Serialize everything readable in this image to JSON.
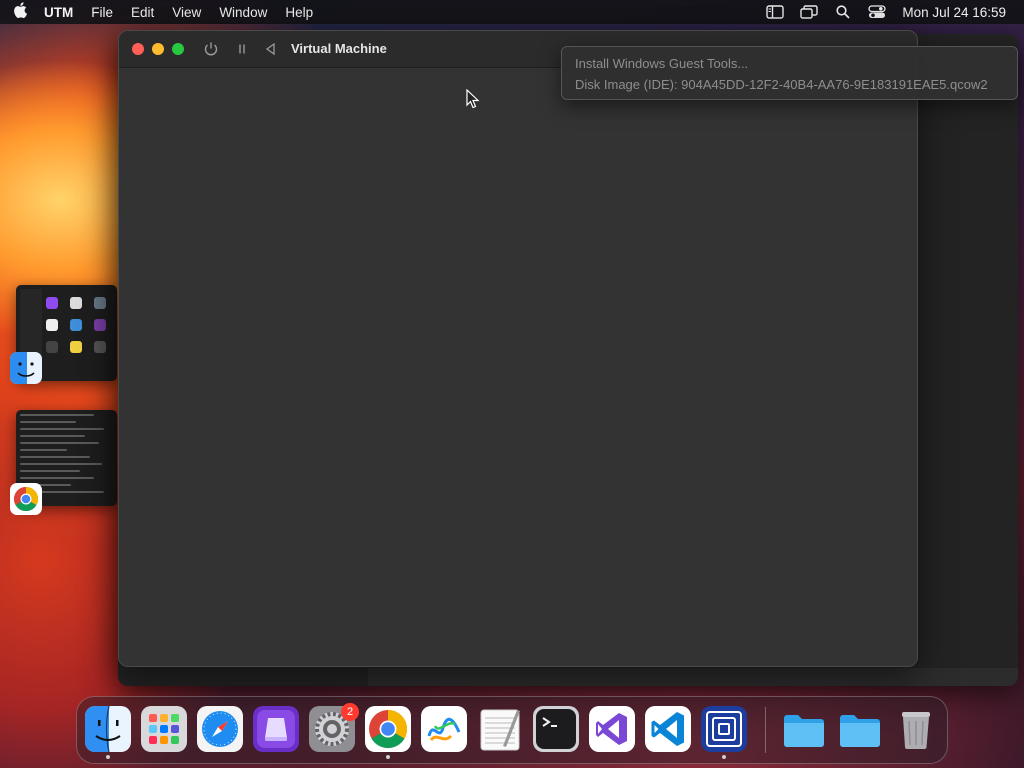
{
  "menubar": {
    "app_name": "UTM",
    "menus": [
      "File",
      "Edit",
      "View",
      "Window",
      "Help"
    ],
    "clock": "Mon Jul 24  16:59",
    "status_icons": [
      "sidebar-icon",
      "screen-mirroring-icon",
      "spotlight-search-icon",
      "control-center-icon"
    ]
  },
  "vm_window": {
    "title": "Virtual Machine"
  },
  "drive_menu": {
    "items": [
      "Install Windows Guest Tools...",
      "Disk Image (IDE): 904A45DD-12F2-40B4-AA76-9E183191EAE5.qcow2"
    ]
  },
  "dock": {
    "apps": [
      "finder",
      "launchpad",
      "safari",
      "xcode-simulator",
      "system-settings",
      "chrome",
      "freeform",
      "textedit",
      "terminal",
      "visual-studio",
      "vscode",
      "utm"
    ],
    "folders": [
      "downloads-folder",
      "documents-folder",
      "trash"
    ],
    "settings_badge": "2"
  },
  "colors": {
    "close": "#ff5f57",
    "minimize": "#febc2e",
    "zoom": "#28c840",
    "badge": "#ff3b30"
  }
}
